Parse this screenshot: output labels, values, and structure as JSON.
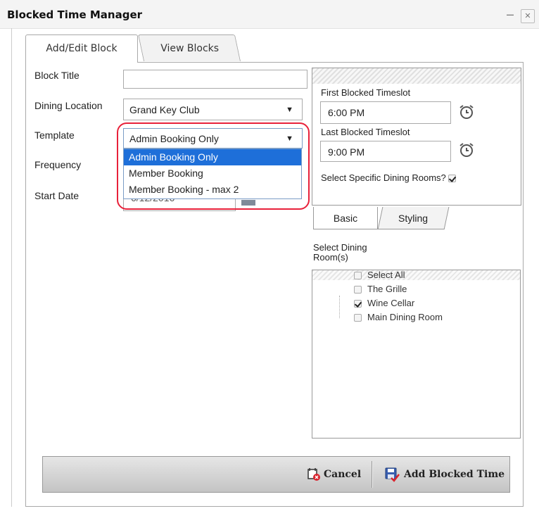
{
  "window": {
    "title": "Blocked Time Manager",
    "minimize_glyph": "–",
    "close_glyph": "✕"
  },
  "tabs": [
    {
      "label": "Add/Edit Block",
      "active": true
    },
    {
      "label": "View Blocks",
      "active": false
    }
  ],
  "form": {
    "block_title": {
      "label": "Block Title",
      "value": ""
    },
    "dining_location": {
      "label": "Dining Location",
      "value": "Grand Key Club"
    },
    "template": {
      "label": "Template",
      "value": "Admin Booking Only",
      "options": [
        "Admin Booking Only",
        "Member Booking",
        "Member Booking - max 2"
      ],
      "selected_index": 0
    },
    "frequency": {
      "label": "Frequency"
    },
    "start_date": {
      "label": "Start Date",
      "value_partial": "6/12/2016"
    }
  },
  "timeslots": {
    "first_label": "First Blocked Timeslot",
    "first_value": "6:00 PM",
    "last_label": "Last Blocked Timeslot",
    "last_value": "9:00 PM",
    "specific_rooms_label": "Select Specific Dining Rooms?",
    "specific_rooms_checked": true
  },
  "subtabs": [
    {
      "label": "Basic",
      "active": true
    },
    {
      "label": "Styling",
      "active": false
    }
  ],
  "rooms": {
    "label_line1": "Select Dining",
    "label_line2": "Room(s)",
    "items": [
      {
        "label": "Select All",
        "checked": false
      },
      {
        "label": "The Grille",
        "checked": false
      },
      {
        "label": "Wine Cellar",
        "checked": true
      },
      {
        "label": "Main Dining Room",
        "checked": false
      }
    ]
  },
  "footer": {
    "cancel_label": "Cancel",
    "add_label": "Add Blocked Time"
  },
  "icons": {
    "clock": "alarm-clock-icon",
    "cancel": "calendar-delete-icon",
    "add": "save-check-icon"
  },
  "colors": {
    "selection": "#1e6fd9",
    "highlight_ring": "#e8213a"
  }
}
